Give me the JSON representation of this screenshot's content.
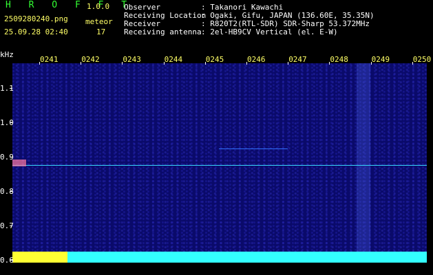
{
  "header": {
    "app_title": "H R O F F T",
    "version": "1.0.0",
    "filename": "2509280240.png",
    "datetime": "25.09.28 02:40",
    "meteor_label": "meteor",
    "meteor_count": "17",
    "observer_label": "Observer",
    "observer_value": ": Takanori Kawachi",
    "location_label": "Receiving Location",
    "location_value": ": Ogaki, Gifu, JAPAN (136.60E, 35.35N)",
    "receiver_label": "Receiver",
    "receiver_value": ": R820T2(RTL-SDR) SDR-Sharp 53.372MHz",
    "antenna_label": "Receiving antenna",
    "antenna_value": ": 2el-HB9CV Vertical (el. E-W)"
  },
  "plot": {
    "y_unit": "kHz",
    "y_ticks": [
      "1.1",
      "1.0",
      "0.9",
      "0.8",
      "0.7",
      "0.6"
    ],
    "x_ticks": [
      "0241",
      "0242",
      "0243",
      "0244",
      "0245",
      "0246",
      "0247",
      "0248",
      "0249",
      "0250"
    ]
  }
}
